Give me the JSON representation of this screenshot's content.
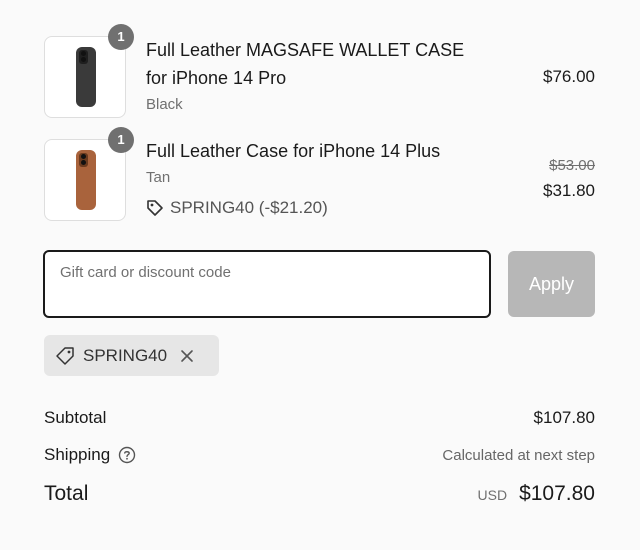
{
  "line_items": [
    {
      "quantity": "1",
      "title": "Full Leather MAGSAFE WALLET CASE for iPhone 14 Pro",
      "variant": "Black",
      "price": "$76.00",
      "image_icon": "black-phone-case"
    },
    {
      "quantity": "1",
      "title": "Full Leather Case for iPhone 14 Plus",
      "variant": "Tan",
      "discount": "SPRING40 (-$21.20)",
      "original_price": "$53.00",
      "price": "$31.80",
      "image_icon": "tan-phone-case"
    }
  ],
  "discount_form": {
    "placeholder": "Gift card or discount code",
    "value": "",
    "apply_label": "Apply"
  },
  "applied_code": {
    "code": "SPRING40",
    "icon": "tag-icon",
    "remove_icon": "close-icon"
  },
  "summary": {
    "subtotal_label": "Subtotal",
    "subtotal_value": "$107.80",
    "shipping_label": "Shipping",
    "shipping_value": "Calculated at next step",
    "total_label": "Total",
    "currency": "USD",
    "total_value": "$107.80"
  },
  "colors": {
    "badge_bg": "#707070",
    "apply_disabled_bg": "#b7b7b7",
    "chip_bg": "#e6e6e6",
    "input_border": "#1a1a1a"
  }
}
